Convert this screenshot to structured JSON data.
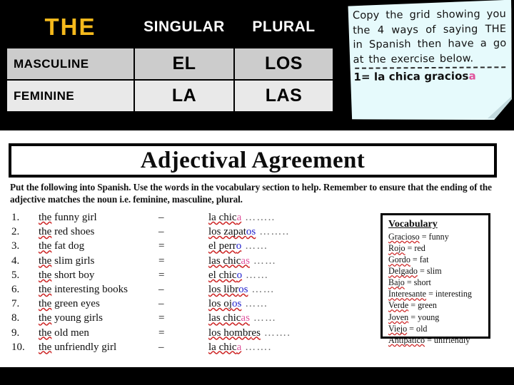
{
  "grid": {
    "header": {
      "the_label": "THE",
      "singular_label": "SINGULAR",
      "plural_label": "PLURAL"
    },
    "rows": [
      {
        "gender": "MASCULINE",
        "singular": "EL",
        "plural": "LOS"
      },
      {
        "gender": "FEMININE",
        "singular": "LA",
        "plural": "LAS"
      }
    ],
    "colors": {
      "the_accent": "#F5B91C",
      "masculine_text": "#0000DD",
      "feminine_text": "#EE3399",
      "header_bg": "#000000",
      "masculine_row_bg": "#CCCCCC",
      "feminine_row_bg": "#E9E9E9"
    }
  },
  "note": {
    "body": "Copy the grid showing you the 4 ways of saying THE in Spanish then have a go at the exercise below.",
    "example_prefix": "1= la chica gracios",
    "example_ending": "a",
    "bg_color": "#E6FAFC",
    "ending_color": "#E0519B"
  },
  "worksheet": {
    "title": "Adjectival Agreement",
    "instructions": "Put the following into Spanish. Use the words in the vocabulary section to help. Remember to ensure that the ending of the adjective matches the noun i.e. feminine, masculine, plural.",
    "exercises": [
      {
        "num": "1.",
        "english": "the funny girl",
        "sep": "–",
        "es_prefix": "la chic",
        "es_ending": "a",
        "ending_color": "pink",
        "dots": "…….."
      },
      {
        "num": "2.",
        "english": "the red shoes",
        "sep": "–",
        "es_prefix": "los zapat",
        "es_ending": "os",
        "ending_color": "blue",
        "dots": "…….."
      },
      {
        "num": "3.",
        "english": "the fat dog",
        "sep": "=",
        "es_prefix": "el perr",
        "es_ending": "o",
        "ending_color": "blue",
        "dots": "……"
      },
      {
        "num": "4.",
        "english": "the slim girls",
        "sep": "=",
        "es_prefix": "las chic",
        "es_ending": "as",
        "ending_color": "pink",
        "dots": "……"
      },
      {
        "num": "5.",
        "english": "the short boy",
        "sep": "=",
        "es_prefix": "el chic",
        "es_ending": "o",
        "ending_color": "blue",
        "dots": "……"
      },
      {
        "num": "6.",
        "english": "the interesting books",
        "sep": "–",
        "es_prefix": "los libr",
        "es_ending": "os",
        "ending_color": "blue",
        "dots": "……"
      },
      {
        "num": "7.",
        "english": "the green eyes",
        "sep": "–",
        "es_prefix": "los oj",
        "es_ending": "os",
        "ending_color": "blue",
        "dots": "……"
      },
      {
        "num": "8.",
        "english": "the young girls",
        "sep": "=",
        "es_prefix": "las chic",
        "es_ending": "as",
        "ending_color": "pink",
        "dots": "……"
      },
      {
        "num": "9.",
        "english": "the old men",
        "sep": "=",
        "es_prefix": "los hombr",
        "es_ending": "es",
        "ending_color": "none",
        "dots": "……."
      },
      {
        "num": "10.",
        "english": "the unfriendly girl",
        "sep": "–",
        "es_prefix": "la chic",
        "es_ending": "a",
        "ending_color": "pink",
        "dots": "……."
      }
    ],
    "vocabulary": {
      "title": "Vocabulary",
      "entries": [
        "Gracioso = funny",
        "Rojo = red",
        "Gordo = fat",
        "Delgado = slim",
        "Bajo = short",
        "Interesante = interesting",
        "Verde = green",
        "Joven = young",
        "Viejo = old",
        "Antipático = unfriendly"
      ]
    }
  }
}
